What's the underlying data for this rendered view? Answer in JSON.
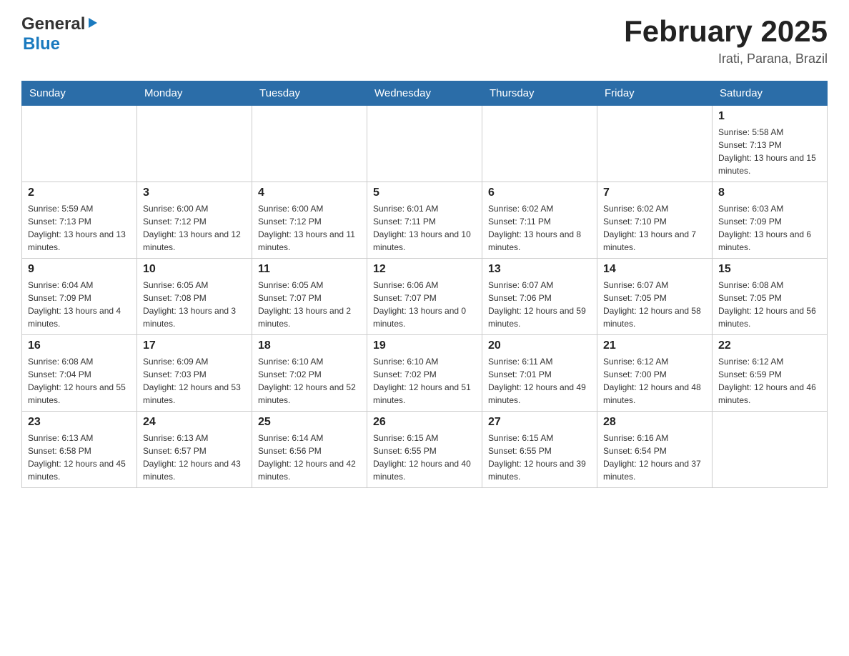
{
  "header": {
    "logo_general": "General",
    "logo_blue": "Blue",
    "title": "February 2025",
    "subtitle": "Irati, Parana, Brazil"
  },
  "days_of_week": [
    "Sunday",
    "Monday",
    "Tuesday",
    "Wednesday",
    "Thursday",
    "Friday",
    "Saturday"
  ],
  "weeks": [
    [
      {
        "day": "",
        "info": ""
      },
      {
        "day": "",
        "info": ""
      },
      {
        "day": "",
        "info": ""
      },
      {
        "day": "",
        "info": ""
      },
      {
        "day": "",
        "info": ""
      },
      {
        "day": "",
        "info": ""
      },
      {
        "day": "1",
        "info": "Sunrise: 5:58 AM\nSunset: 7:13 PM\nDaylight: 13 hours and 15 minutes."
      }
    ],
    [
      {
        "day": "2",
        "info": "Sunrise: 5:59 AM\nSunset: 7:13 PM\nDaylight: 13 hours and 13 minutes."
      },
      {
        "day": "3",
        "info": "Sunrise: 6:00 AM\nSunset: 7:12 PM\nDaylight: 13 hours and 12 minutes."
      },
      {
        "day": "4",
        "info": "Sunrise: 6:00 AM\nSunset: 7:12 PM\nDaylight: 13 hours and 11 minutes."
      },
      {
        "day": "5",
        "info": "Sunrise: 6:01 AM\nSunset: 7:11 PM\nDaylight: 13 hours and 10 minutes."
      },
      {
        "day": "6",
        "info": "Sunrise: 6:02 AM\nSunset: 7:11 PM\nDaylight: 13 hours and 8 minutes."
      },
      {
        "day": "7",
        "info": "Sunrise: 6:02 AM\nSunset: 7:10 PM\nDaylight: 13 hours and 7 minutes."
      },
      {
        "day": "8",
        "info": "Sunrise: 6:03 AM\nSunset: 7:09 PM\nDaylight: 13 hours and 6 minutes."
      }
    ],
    [
      {
        "day": "9",
        "info": "Sunrise: 6:04 AM\nSunset: 7:09 PM\nDaylight: 13 hours and 4 minutes."
      },
      {
        "day": "10",
        "info": "Sunrise: 6:05 AM\nSunset: 7:08 PM\nDaylight: 13 hours and 3 minutes."
      },
      {
        "day": "11",
        "info": "Sunrise: 6:05 AM\nSunset: 7:07 PM\nDaylight: 13 hours and 2 minutes."
      },
      {
        "day": "12",
        "info": "Sunrise: 6:06 AM\nSunset: 7:07 PM\nDaylight: 13 hours and 0 minutes."
      },
      {
        "day": "13",
        "info": "Sunrise: 6:07 AM\nSunset: 7:06 PM\nDaylight: 12 hours and 59 minutes."
      },
      {
        "day": "14",
        "info": "Sunrise: 6:07 AM\nSunset: 7:05 PM\nDaylight: 12 hours and 58 minutes."
      },
      {
        "day": "15",
        "info": "Sunrise: 6:08 AM\nSunset: 7:05 PM\nDaylight: 12 hours and 56 minutes."
      }
    ],
    [
      {
        "day": "16",
        "info": "Sunrise: 6:08 AM\nSunset: 7:04 PM\nDaylight: 12 hours and 55 minutes."
      },
      {
        "day": "17",
        "info": "Sunrise: 6:09 AM\nSunset: 7:03 PM\nDaylight: 12 hours and 53 minutes."
      },
      {
        "day": "18",
        "info": "Sunrise: 6:10 AM\nSunset: 7:02 PM\nDaylight: 12 hours and 52 minutes."
      },
      {
        "day": "19",
        "info": "Sunrise: 6:10 AM\nSunset: 7:02 PM\nDaylight: 12 hours and 51 minutes."
      },
      {
        "day": "20",
        "info": "Sunrise: 6:11 AM\nSunset: 7:01 PM\nDaylight: 12 hours and 49 minutes."
      },
      {
        "day": "21",
        "info": "Sunrise: 6:12 AM\nSunset: 7:00 PM\nDaylight: 12 hours and 48 minutes."
      },
      {
        "day": "22",
        "info": "Sunrise: 6:12 AM\nSunset: 6:59 PM\nDaylight: 12 hours and 46 minutes."
      }
    ],
    [
      {
        "day": "23",
        "info": "Sunrise: 6:13 AM\nSunset: 6:58 PM\nDaylight: 12 hours and 45 minutes."
      },
      {
        "day": "24",
        "info": "Sunrise: 6:13 AM\nSunset: 6:57 PM\nDaylight: 12 hours and 43 minutes."
      },
      {
        "day": "25",
        "info": "Sunrise: 6:14 AM\nSunset: 6:56 PM\nDaylight: 12 hours and 42 minutes."
      },
      {
        "day": "26",
        "info": "Sunrise: 6:15 AM\nSunset: 6:55 PM\nDaylight: 12 hours and 40 minutes."
      },
      {
        "day": "27",
        "info": "Sunrise: 6:15 AM\nSunset: 6:55 PM\nDaylight: 12 hours and 39 minutes."
      },
      {
        "day": "28",
        "info": "Sunrise: 6:16 AM\nSunset: 6:54 PM\nDaylight: 12 hours and 37 minutes."
      },
      {
        "day": "",
        "info": ""
      }
    ]
  ]
}
